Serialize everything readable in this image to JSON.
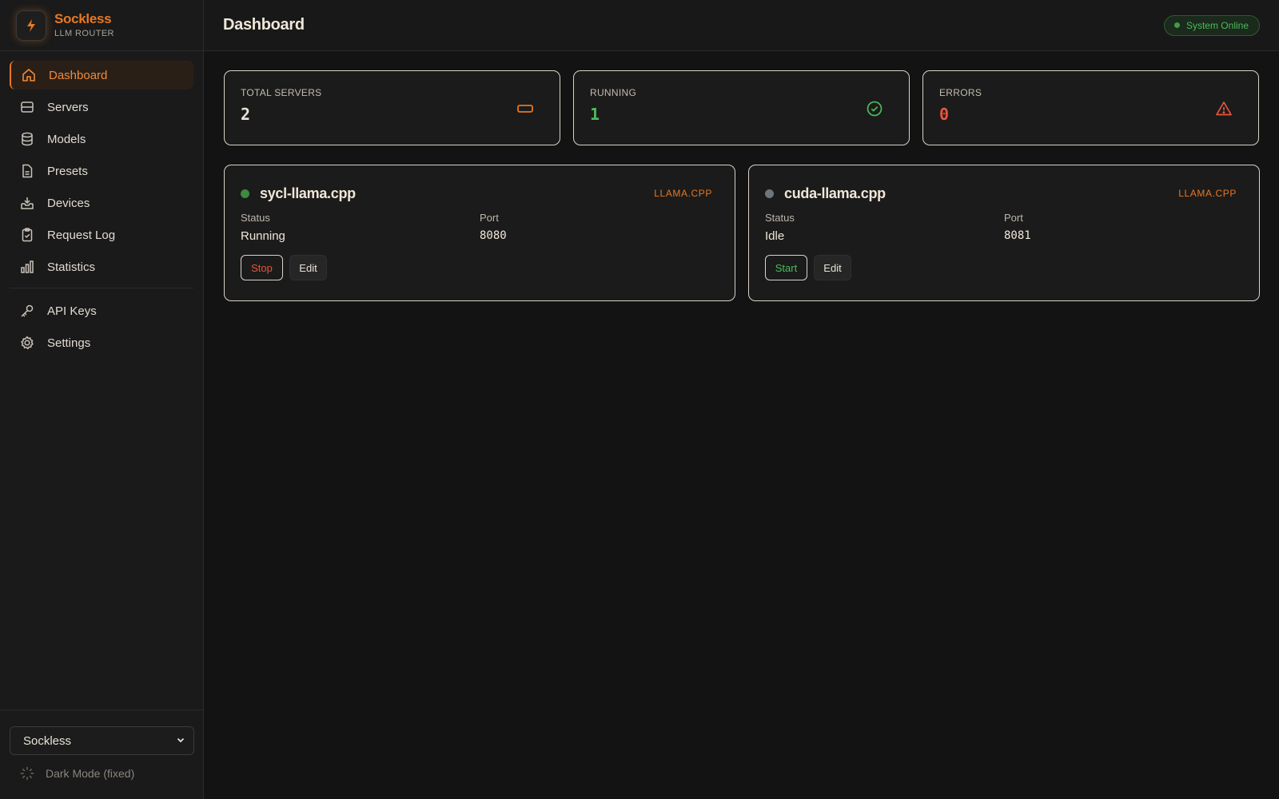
{
  "brand": {
    "name": "Sockless",
    "subtitle": "LLM ROUTER"
  },
  "sidebar": {
    "items": [
      {
        "label": "Dashboard",
        "icon": "home-icon",
        "active": true
      },
      {
        "label": "Servers",
        "icon": "server-icon"
      },
      {
        "label": "Models",
        "icon": "database-icon"
      },
      {
        "label": "Presets",
        "icon": "document-icon"
      },
      {
        "label": "Devices",
        "icon": "inbox-icon"
      },
      {
        "label": "Request Log",
        "icon": "clipboard-icon"
      },
      {
        "label": "Statistics",
        "icon": "bar-chart-icon"
      }
    ],
    "secondary_items": [
      {
        "label": "API Keys",
        "icon": "key-icon"
      },
      {
        "label": "Settings",
        "icon": "gear-icon"
      }
    ],
    "workspace_select": {
      "value": "Sockless"
    },
    "dark_mode_label": "Dark Mode (fixed)"
  },
  "header": {
    "title": "Dashboard",
    "status": "System Online"
  },
  "stats": [
    {
      "label": "TOTAL SERVERS",
      "value": "2",
      "color": "#e8e2d8",
      "icon": "server-icon",
      "icon_color": "#e87722"
    },
    {
      "label": "RUNNING",
      "value": "1",
      "color": "#4cbb5a",
      "icon": "check-circle-icon",
      "icon_color": "#4cbb5a"
    },
    {
      "label": "ERRORS",
      "value": "0",
      "color": "#e8553a",
      "icon": "warning-icon",
      "icon_color": "#e8553a"
    }
  ],
  "servers": [
    {
      "name": "sycl-llama.cpp",
      "type": "LLAMA.CPP",
      "status_label": "Status",
      "status": "Running",
      "port_label": "Port",
      "port": "8080",
      "dot_color": "#3e8a3e",
      "action": "Stop",
      "edit": "Edit"
    },
    {
      "name": "cuda-llama.cpp",
      "type": "LLAMA.CPP",
      "status_label": "Status",
      "status": "Idle",
      "port_label": "Port",
      "port": "8081",
      "dot_color": "#6e7480",
      "action": "Start",
      "edit": "Edit"
    }
  ],
  "colors": {
    "accent": "#e87722",
    "success": "#4cbb5a",
    "danger": "#e8553a"
  }
}
